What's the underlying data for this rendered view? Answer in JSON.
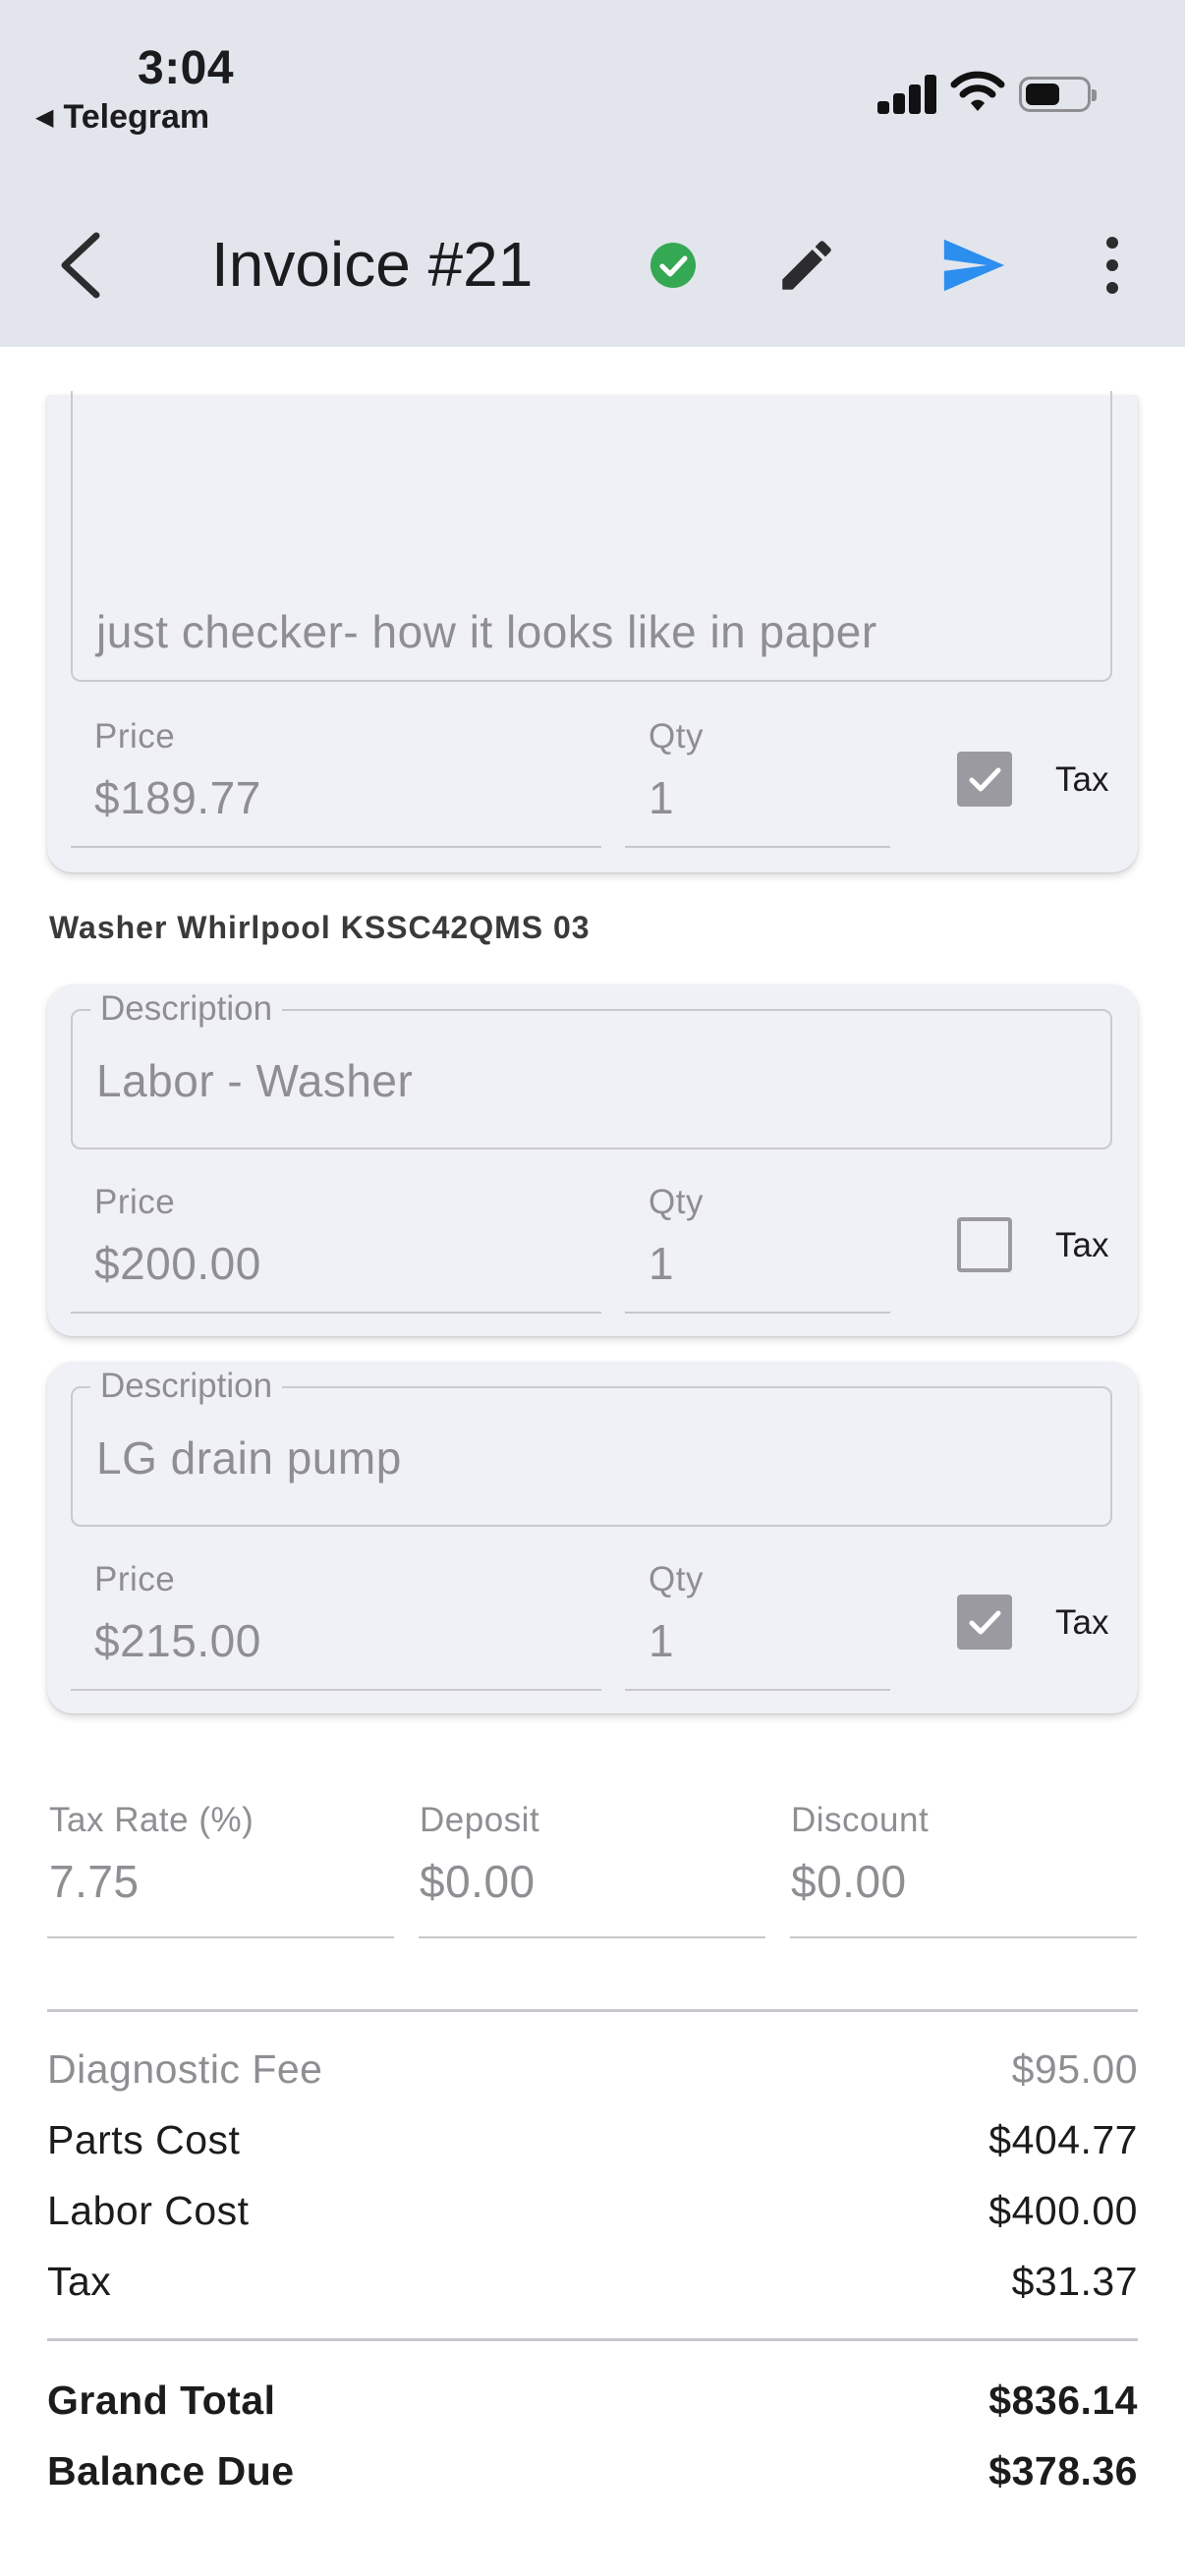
{
  "status_bar": {
    "time": "3:04",
    "back_app": "Telegram",
    "back_glyph": "◀"
  },
  "app_bar": {
    "title": "Invoice #21",
    "icons": [
      "back-chevron-icon",
      "check-circle-icon",
      "edit-pencil-icon",
      "send-icon",
      "more-vertical-icon"
    ],
    "accent_colors": {
      "check": "#34a853",
      "send": "#2c8ff0"
    }
  },
  "items_top": {
    "description": "just checker- how it looks like in paper",
    "price_label": "Price",
    "price": "$189.77",
    "qty_label": "Qty",
    "qty": "1",
    "tax_label": "Tax",
    "tax_checked": true
  },
  "section": {
    "title": "Washer Whirlpool KSSC42QMS 03"
  },
  "items": [
    {
      "description_label": "Description",
      "description": "Labor - Washer",
      "price_label": "Price",
      "price": "$200.00",
      "qty_label": "Qty",
      "qty": "1",
      "tax_label": "Tax",
      "tax_checked": false
    },
    {
      "description_label": "Description",
      "description": "LG drain pump",
      "price_label": "Price",
      "price": "$215.00",
      "qty_label": "Qty",
      "qty": "1",
      "tax_label": "Tax",
      "tax_checked": true
    }
  ],
  "fields": {
    "tax_rate_label": "Tax Rate (%)",
    "tax_rate": "7.75",
    "deposit_label": "Deposit",
    "deposit": "$0.00",
    "discount_label": "Discount",
    "discount": "$0.00"
  },
  "summary": {
    "diagnostic_fee_label": "Diagnostic Fee",
    "diagnostic_fee": "$95.00",
    "parts_cost_label": "Parts Cost",
    "parts_cost": "$404.77",
    "labor_cost_label": "Labor Cost",
    "labor_cost": "$400.00",
    "tax_label": "Tax",
    "tax": "$31.37",
    "grand_total_label": "Grand Total",
    "grand_total": "$836.14",
    "balance_due_label": "Balance Due",
    "balance_due": "$378.36"
  }
}
